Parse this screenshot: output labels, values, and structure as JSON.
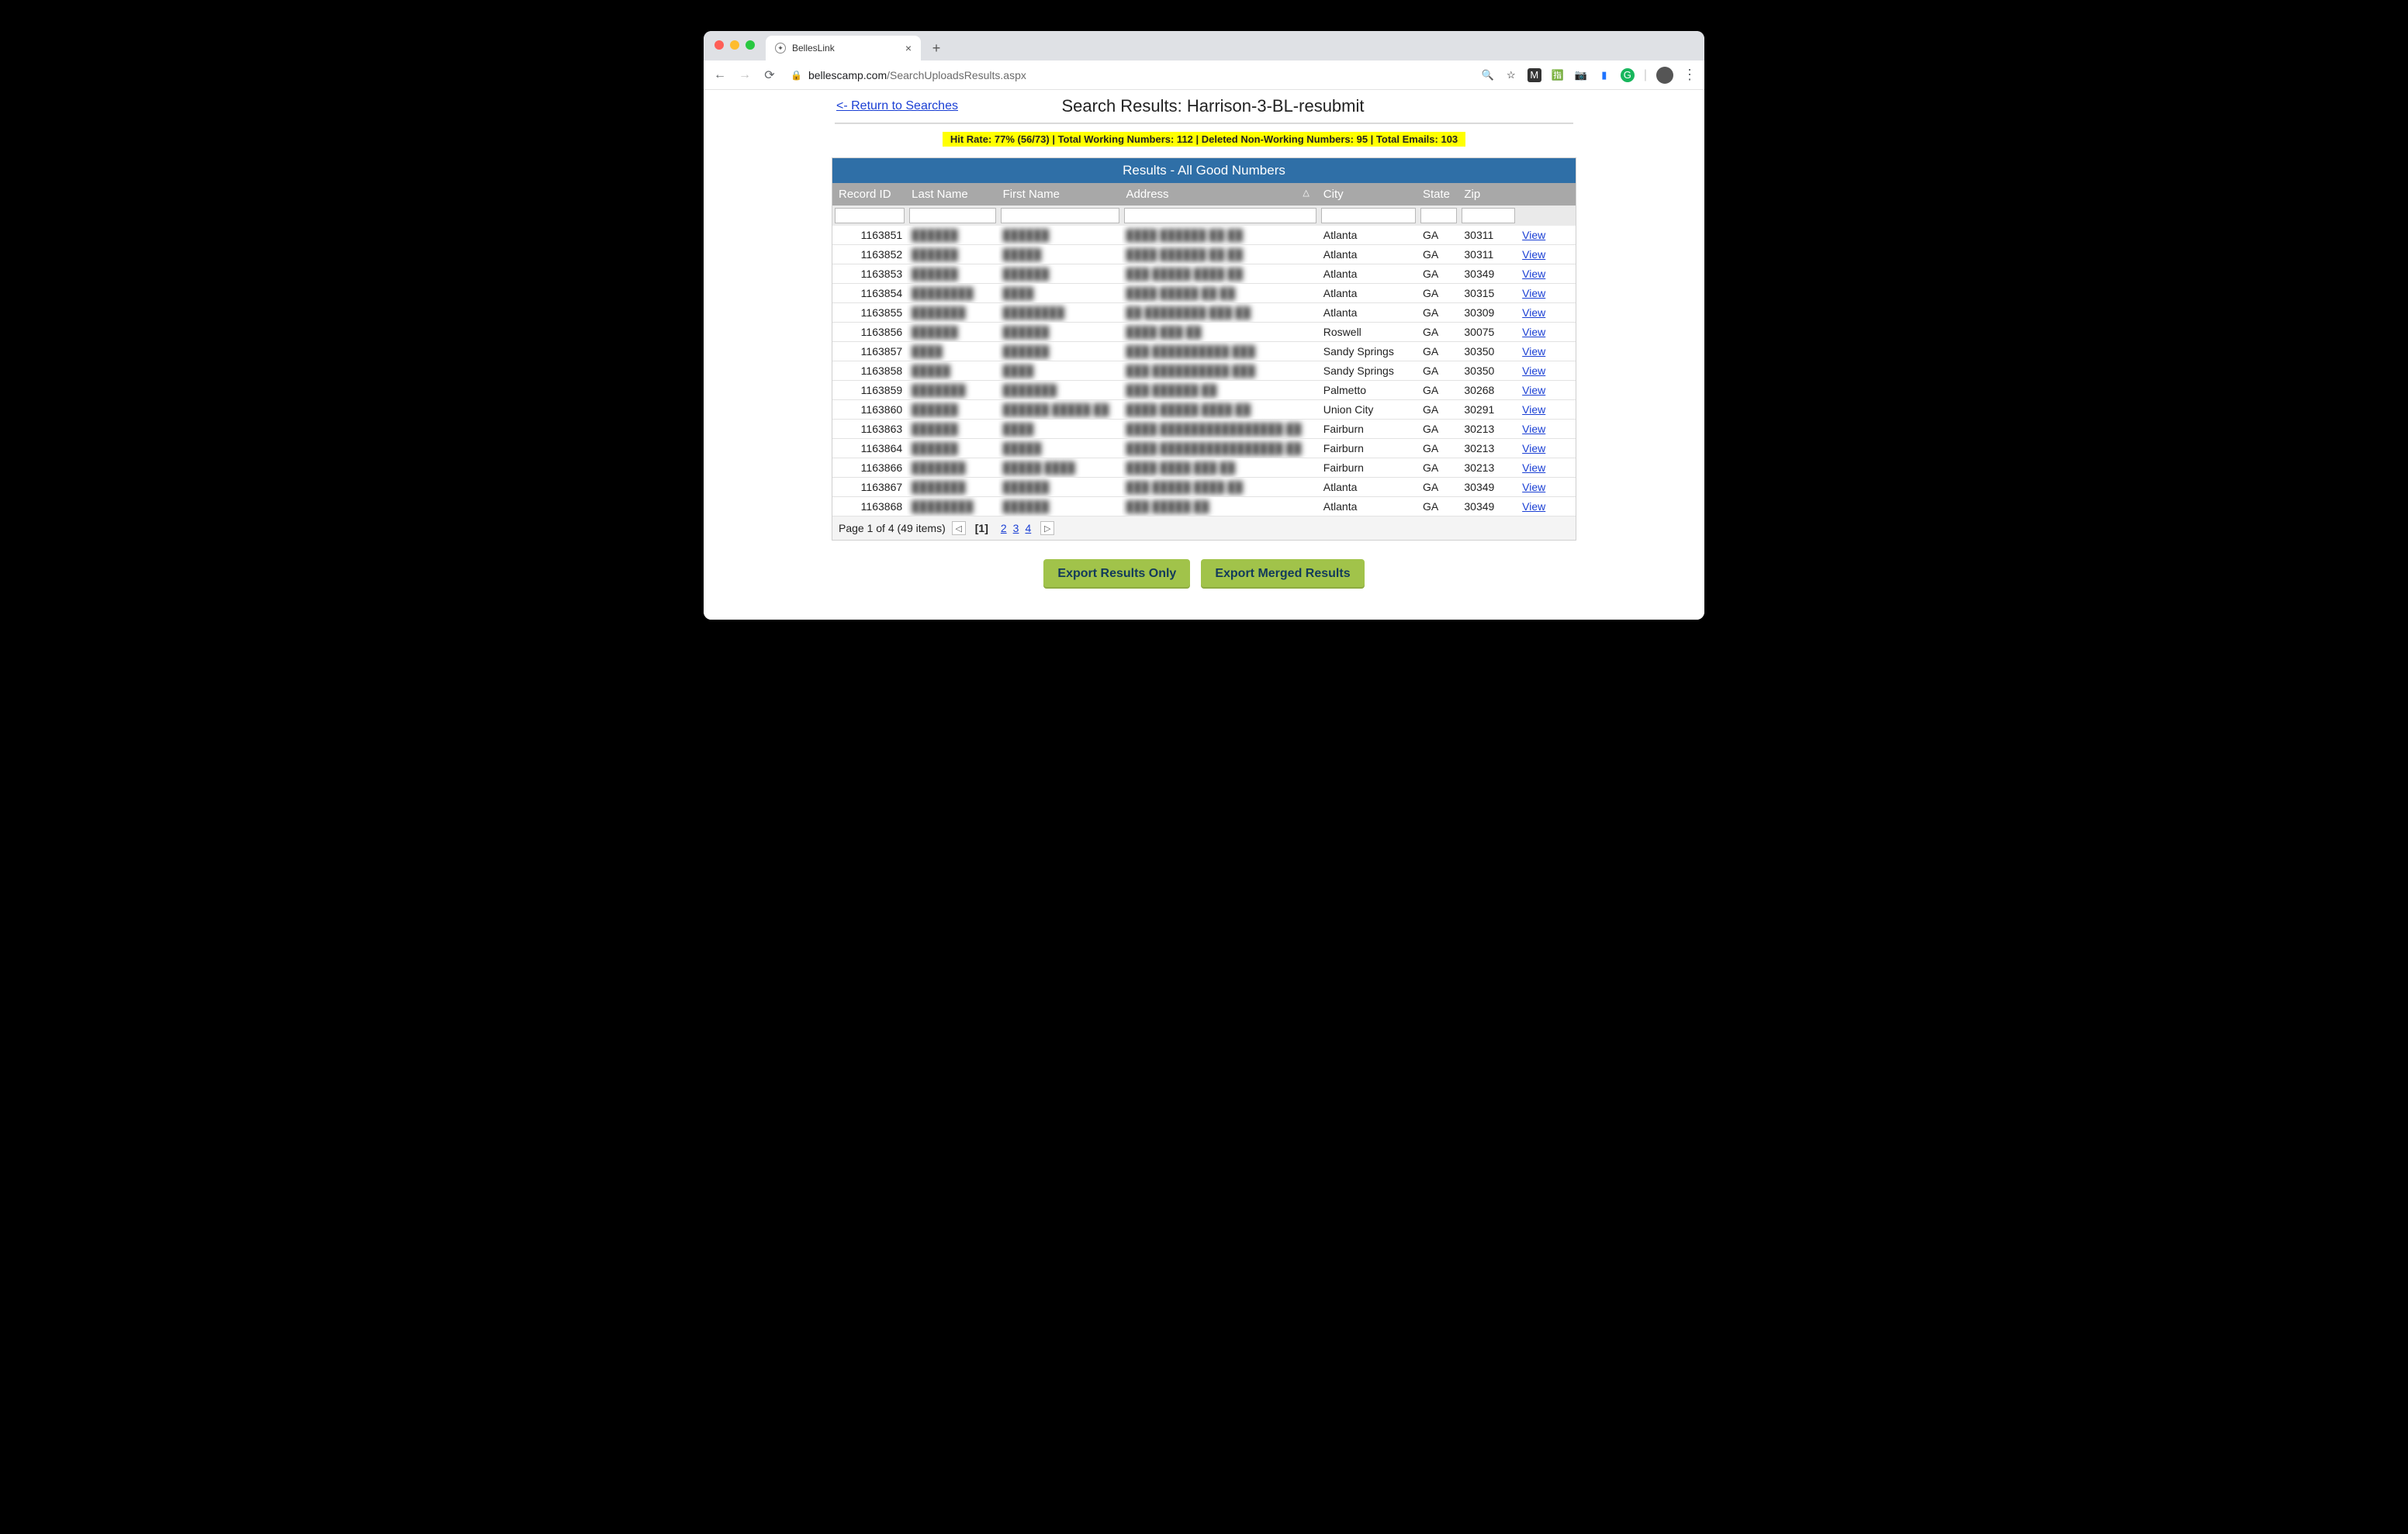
{
  "browser": {
    "tab_title": "BellesLink",
    "url_host": "bellescamp.com",
    "url_path": "/SearchUploadsResults.aspx"
  },
  "header": {
    "return_label": "<- Return to Searches",
    "title": "Search Results: Harrison-3-BL-resubmit",
    "stats": "Hit Rate: 77% (56/73) | Total Working Numbers: 112 | Deleted Non-Working Numbers: 95 | Total Emails: 103"
  },
  "panel_title": "Results - All Good Numbers",
  "columns": {
    "record_id": "Record ID",
    "last_name": "Last Name",
    "first_name": "First Name",
    "address": "Address",
    "city": "City",
    "state": "State",
    "zip": "Zip"
  },
  "view_label": "View",
  "rows": [
    {
      "id": "1163851",
      "last": "██████",
      "first": "██████",
      "addr": "████ ██████ ██ ██",
      "city": "Atlanta",
      "state": "GA",
      "zip": "30311"
    },
    {
      "id": "1163852",
      "last": "██████",
      "first": "█████",
      "addr": "████ ██████ ██ ██",
      "city": "Atlanta",
      "state": "GA",
      "zip": "30311"
    },
    {
      "id": "1163853",
      "last": "██████",
      "first": "██████",
      "addr": "███ █████ ████ ██",
      "city": "Atlanta",
      "state": "GA",
      "zip": "30349"
    },
    {
      "id": "1163854",
      "last": "████████",
      "first": "████",
      "addr": "████ █████ ██ ██",
      "city": "Atlanta",
      "state": "GA",
      "zip": "30315"
    },
    {
      "id": "1163855",
      "last": "███████",
      "first": "████████",
      "addr": "██ ████████ ███ ██",
      "city": "Atlanta",
      "state": "GA",
      "zip": "30309"
    },
    {
      "id": "1163856",
      "last": "██████",
      "first": "██████",
      "addr": "████ ███ ██",
      "city": "Roswell",
      "state": "GA",
      "zip": "30075"
    },
    {
      "id": "1163857",
      "last": "████",
      "first": "██████",
      "addr": "███ ██████████ ███",
      "city": "Sandy Springs",
      "state": "GA",
      "zip": "30350"
    },
    {
      "id": "1163858",
      "last": "█████",
      "first": "████",
      "addr": "███ ██████████ ███",
      "city": "Sandy Springs",
      "state": "GA",
      "zip": "30350"
    },
    {
      "id": "1163859",
      "last": "███████",
      "first": "███████",
      "addr": "███ ██████ ██",
      "city": "Palmetto",
      "state": "GA",
      "zip": "30268"
    },
    {
      "id": "1163860",
      "last": "██████",
      "first": "██████ █████ ██",
      "addr": "████ █████ ████ ██",
      "city": "Union City",
      "state": "GA",
      "zip": "30291"
    },
    {
      "id": "1163863",
      "last": "██████",
      "first": "████",
      "addr": "████ ████████████████ ██",
      "city": "Fairburn",
      "state": "GA",
      "zip": "30213"
    },
    {
      "id": "1163864",
      "last": "██████",
      "first": "█████",
      "addr": "████ ████████████████ ██",
      "city": "Fairburn",
      "state": "GA",
      "zip": "30213"
    },
    {
      "id": "1163866",
      "last": "███████",
      "first": "█████ ████",
      "addr": "████ ████ ███ ██",
      "city": "Fairburn",
      "state": "GA",
      "zip": "30213"
    },
    {
      "id": "1163867",
      "last": "███████",
      "first": "██████",
      "addr": "███ █████ ████ ██",
      "city": "Atlanta",
      "state": "GA",
      "zip": "30349"
    },
    {
      "id": "1163868",
      "last": "████████",
      "first": "██████",
      "addr": "███ █████ ██",
      "city": "Atlanta",
      "state": "GA",
      "zip": "30349"
    }
  ],
  "pager": {
    "summary": "Page 1 of 4 (49 items)",
    "current": "[1]",
    "pages": [
      "2",
      "3",
      "4"
    ]
  },
  "exports": {
    "results_only": "Export Results Only",
    "merged": "Export Merged Results"
  }
}
